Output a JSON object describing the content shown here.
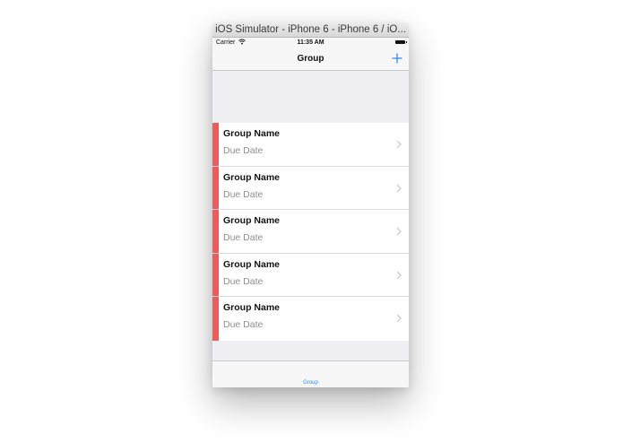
{
  "window": {
    "title": "iOS Simulator - iPhone 6 - iPhone 6 / iO..."
  },
  "status_bar": {
    "carrier": "Carrier",
    "wifi_icon": "wifi-icon",
    "time": "11:35 AM",
    "battery_icon": "battery-icon"
  },
  "nav_bar": {
    "title": "Group",
    "add_icon": "plus-icon"
  },
  "groups": [
    {
      "name": "Group Name",
      "due": "Due Date"
    },
    {
      "name": "Group Name",
      "due": "Due Date"
    },
    {
      "name": "Group Name",
      "due": "Due Date"
    },
    {
      "name": "Group Name",
      "due": "Due Date"
    },
    {
      "name": "Group Name",
      "due": "Due Date"
    }
  ],
  "tab_bar": {
    "items": [
      {
        "label": "Group",
        "selected": true
      }
    ]
  },
  "colors": {
    "accent": "#2a8cf4",
    "stripe": "#ef5a5a",
    "background": "#efeff4",
    "subtitle": "#8e8e93"
  }
}
